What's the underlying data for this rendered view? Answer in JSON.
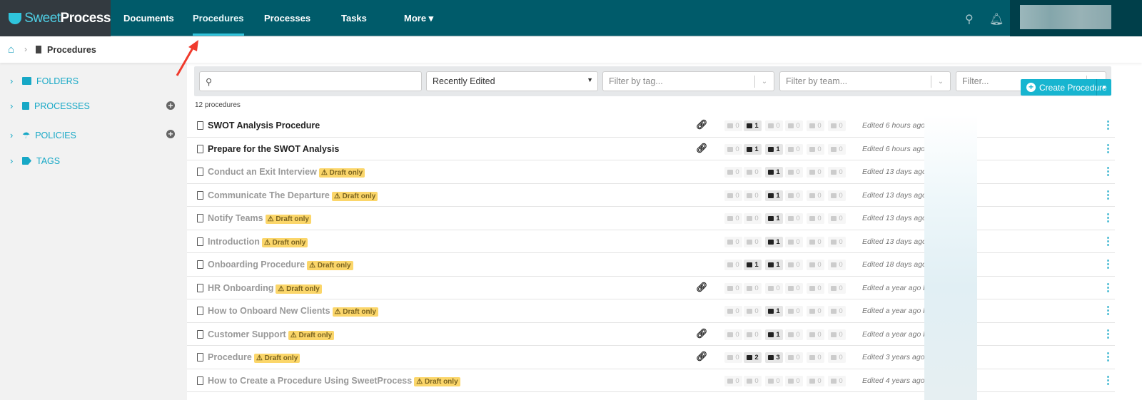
{
  "brand": {
    "name_light": "Sweet",
    "name_bold": "Process"
  },
  "nav": [
    {
      "label": "Documents"
    },
    {
      "label": "Procedures",
      "active": true
    },
    {
      "label": "Processes"
    },
    {
      "label": "Tasks"
    },
    {
      "label": "More ▾"
    }
  ],
  "breadcrumb": {
    "current": "Procedures"
  },
  "create_button": {
    "label": "Create Procedure"
  },
  "sidebar": {
    "items": [
      {
        "label": "FOLDERS"
      },
      {
        "label": "PROCESSES"
      },
      {
        "label": "POLICIES"
      },
      {
        "label": "TAGS"
      }
    ]
  },
  "filters": {
    "search_placeholder": "",
    "sort": "Recently Edited",
    "tag_placeholder": "Filter by tag...",
    "team_placeholder": "Filter by team...",
    "filter_placeholder": "Filter..."
  },
  "count_label": "12 procedures",
  "draft_label": "⚠ Draft only",
  "colors": {
    "nav_bg": "#005b6a",
    "accent": "#17b5d0",
    "draft": "#fbd66a"
  },
  "procedures": [
    {
      "name": "SWOT Analysis Procedure",
      "draft": false,
      "linked": true,
      "stats": [
        0,
        1,
        0,
        0,
        0,
        0
      ],
      "edited": "Edited 6 hours ago by"
    },
    {
      "name": "Prepare for the SWOT Analysis",
      "draft": false,
      "linked": true,
      "stats": [
        0,
        1,
        1,
        0,
        0,
        0
      ],
      "edited": "Edited 6 hours ago by"
    },
    {
      "name": "Conduct an Exit Interview",
      "draft": true,
      "linked": false,
      "stats": [
        0,
        0,
        1,
        0,
        0,
        0
      ],
      "edited": "Edited 13 days ago by"
    },
    {
      "name": "Communicate The Departure",
      "draft": true,
      "linked": false,
      "stats": [
        0,
        0,
        1,
        0,
        0,
        0
      ],
      "edited": "Edited 13 days ago by"
    },
    {
      "name": "Notify Teams",
      "draft": true,
      "linked": false,
      "stats": [
        0,
        0,
        1,
        0,
        0,
        0
      ],
      "edited": "Edited 13 days ago by"
    },
    {
      "name": "Introduction",
      "draft": true,
      "linked": false,
      "stats": [
        0,
        0,
        1,
        0,
        0,
        0
      ],
      "edited": "Edited 13 days ago by"
    },
    {
      "name": "Onboarding Procedure",
      "draft": true,
      "linked": false,
      "stats": [
        0,
        1,
        1,
        0,
        0,
        0
      ],
      "edited": "Edited 18 days ago by"
    },
    {
      "name": "HR Onboarding",
      "draft": true,
      "linked": true,
      "stats": [
        0,
        0,
        0,
        0,
        0,
        0
      ],
      "edited": "Edited a year ago by"
    },
    {
      "name": "How to Onboard New Clients",
      "draft": true,
      "linked": false,
      "stats": [
        0,
        0,
        1,
        0,
        0,
        0
      ],
      "edited": "Edited a year ago by"
    },
    {
      "name": "Customer Support",
      "draft": true,
      "linked": true,
      "stats": [
        0,
        0,
        1,
        0,
        0,
        0
      ],
      "edited": "Edited a year ago by"
    },
    {
      "name": "Procedure",
      "draft": true,
      "linked": true,
      "stats": [
        0,
        2,
        3,
        0,
        0,
        0
      ],
      "edited": "Edited 3 years ago by"
    },
    {
      "name": "How to Create a Procedure Using SweetProcess",
      "draft": true,
      "linked": false,
      "stats": [
        0,
        0,
        0,
        0,
        0,
        0
      ],
      "edited": "Edited 4 years ago by"
    }
  ]
}
